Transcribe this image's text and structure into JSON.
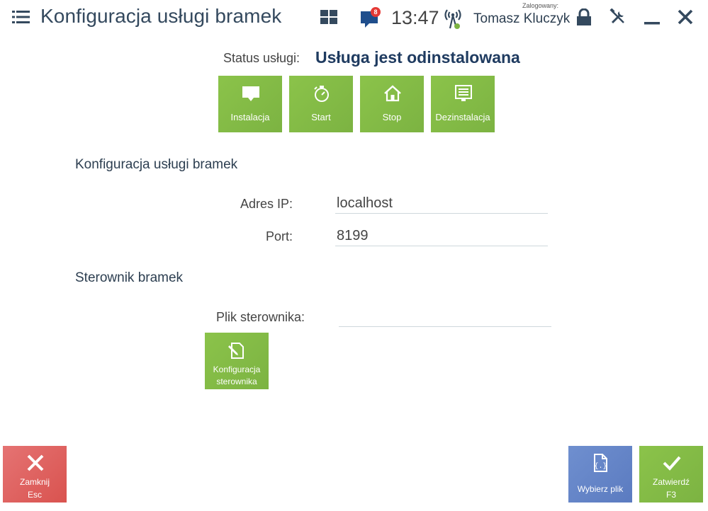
{
  "header": {
    "title": "Konfiguracja usługi bramek",
    "notifications_count": "8",
    "time": "13:47",
    "logged_in_label": "Zalogowany:",
    "user_name": "Tomasz Kluczyk"
  },
  "status": {
    "label": "Status usługi:",
    "value": "Usługa jest odinstalowana"
  },
  "service_buttons": {
    "install": "Instalacja",
    "start": "Start",
    "stop": "Stop",
    "uninstall": "Dezinstalacja"
  },
  "gate_config": {
    "title": "Konfiguracja usługi bramek",
    "ip_label": "Adres IP:",
    "ip_value": "localhost",
    "port_label": "Port:",
    "port_value": "8199"
  },
  "driver": {
    "title": "Sterownik bramek",
    "file_label": "Plik sterownika:",
    "file_value": "",
    "config_button_line1": "Konfiguracja",
    "config_button_line2": "sterownika"
  },
  "bottom_bar": {
    "close_label": "Zamknij",
    "close_shortcut": "Esc",
    "choose_file_label": "Wybierz plik",
    "confirm_label": "Zatwierdź",
    "confirm_shortcut": "F3"
  },
  "colors": {
    "accent_green": "#7cb342",
    "close_red": "#d9534f",
    "choose_blue": "#5b7bc0",
    "status_text": "#1f3b60"
  },
  "icons": {
    "menu": "hamburger-menu-icon",
    "tiles": "tiles-grid-icon",
    "chat": "chat-bubble-icon",
    "signal": "signal-antenna-icon",
    "lock": "lock-icon",
    "tools": "tools-icon",
    "minimize": "minimize-icon",
    "close": "close-icon"
  }
}
